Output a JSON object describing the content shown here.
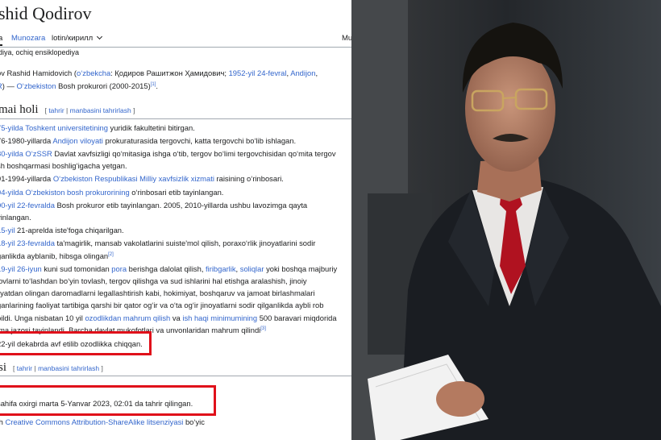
{
  "article": {
    "title": "shid Qodirov",
    "tabs": {
      "article": "a",
      "talk": "Munozara",
      "script": "lotin/кирилл",
      "right": "Mu"
    },
    "tagline": "diya, ochiq ensiklopediya",
    "intro": {
      "l1a": "ov Rashid Hamidovich (",
      "l1b": "o‘zbekcha",
      "l1c": ": Қодиров Рашитжон Ҳамидович; ",
      "l1d": "1952-yil 24-fevral",
      "l1e": ", ",
      "l1f": "Andijon",
      "l1g": ",",
      "l2a": "R",
      "l2b": ") — ",
      "l2c": "O‘zbekiston",
      "l2d": " Bosh prokurori (2000-2015)",
      "l2e": "[1]",
      "l2f": "."
    },
    "section1": {
      "heading": "mai holi",
      "edit_open": "[ ",
      "edit1": "tahrir",
      "edit_sep": " | ",
      "edit2": "manbasini tahrirlash",
      "edit_close": " ]"
    },
    "bio": [
      {
        "a": "75-yilda Toshkent universitetining",
        "b": " yuridik fakultetini bitirgan."
      },
      {
        "a": "",
        "b": "76-1980-yillarda ",
        "c": "Andijon viloyati",
        "d": " prokuraturasida tergovchi, katta tergovchi bo‘lib ishlagan."
      },
      {
        "a": "80-yilda O‘zSSR",
        "b": " Davlat xavfsizligi qo‘mitasiga ishga o‘tib, tergov bo‘limi tergovchisidan qo‘mita tergov"
      },
      {
        "a": "",
        "b": "sh boshqarmasi boshligʻigacha yetgan."
      },
      {
        "a": "",
        "b": "91-1994-yillarda ",
        "c": "O‘zbekiston Respublikasi Milliy xavfsizlik xizmati",
        "d": " raisining o‘rinbosari."
      },
      {
        "a": "94-yilda O‘zbekiston bosh prokurorining",
        "b": " o‘rinbosari etib tayinlangan."
      },
      {
        "a": "00-yil 22-fevralda",
        "b": " Bosh prokuror etib tayinlangan. 2005, 2010-yillarda ushbu lavozimga qayta"
      },
      {
        "a": "",
        "b": "yinlangan."
      },
      {
        "a": "15-yil",
        "b": " 21-aprelda iste'foga chiqarilgan."
      },
      {
        "a": "18-yil 23-fevralda",
        "b": " ta'magirlik, mansab vakolatlarini suiste'mol qilish, poraxo‘rlik jinoyatlarini sodir"
      },
      {
        "a": "",
        "b": "ganlikda ayblanib, hibsga olingan",
        "c": "",
        "d": ""
      },
      {
        "a": "19-yil 26-iyun",
        "b": " kuni sud tomonidan ",
        "c": "pora",
        "d": " berishga dalolat qilish, ",
        "e": "firibgarlik",
        "f": ", ",
        "g": "soliqlar",
        "h": " yoki boshqa majburiy"
      },
      {
        "a": "",
        "b": "lovlarni to‘lashdan bo‘yin tovlash, tergov qilishga va sud ishlarini hal etishga aralashish, jinoiy"
      },
      {
        "a": "",
        "b": "liyatdan olingan daromadlarni legallashtirish kabi, hokimiyat, boshqaruv va jamoat birlashmalari"
      },
      {
        "a": "",
        "b": "ganlarining faoliyat tartibiga qarshi bir qator og‘ir va o‘ta og‘ir jinoyatlarni sodir qilganlikda aybli rob"
      },
      {
        "a": "",
        "b": "bildi. Unga nisbatan 10 yil ",
        "c": "ozodlikdan mahrum qilish",
        "d": " va ",
        "e": "ish haqi minimumining",
        "f": " 500 baravari miqdorida"
      },
      {
        "a": "",
        "b": "ima jazosi tayinlandi. Barcha davlat mukofotlari va unvonlaridan mahrum qilindi"
      },
      {
        "a": "",
        "b": "22-yil dekabrda avf etilib ozodlikka chiqqan."
      }
    ],
    "refs": {
      "r2": "[2]",
      "r3": "[3]"
    },
    "section2": {
      "heading": "si",
      "edit_open": "[ ",
      "edit1": "tahrir",
      "edit_sep": " | ",
      "edit2": "manbasini tahrirlash",
      "edit_close": " ]"
    },
    "footer": {
      "lastedit": "sahifa oxirgi marta 5-Yanvar 2023, 02:01 da tahrir qilingan.",
      "license_a": "th ",
      "license_b": "Creative Commons Attribution-ShareAlike litsenziyasi",
      "license_c": " bo‘yic"
    }
  },
  "colors": {
    "link": "#3366cc",
    "highlight": "#e0101a",
    "text": "#202122"
  },
  "icons": {
    "dropdown": "chevron-down-icon"
  }
}
